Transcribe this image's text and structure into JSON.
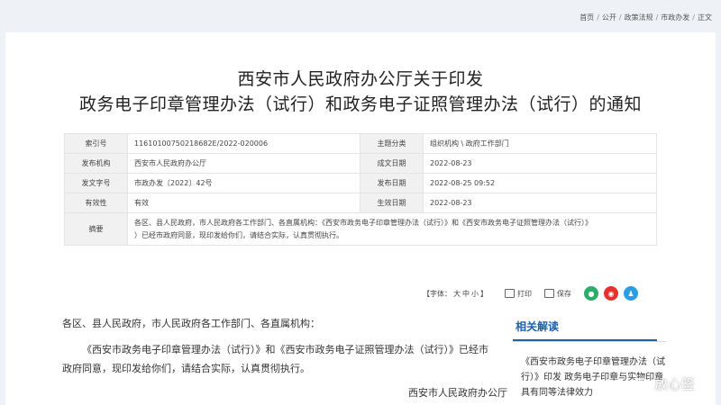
{
  "breadcrumb": [
    "首页",
    "公开",
    "政策法规",
    "市政办发",
    "正文"
  ],
  "title_line1": "西安市人民政府办公厅关于印发",
  "title_line2": "政务电子印章管理办法（试行）和政务电子证照管理办法（试行）的通知",
  "meta": {
    "index_label": "索引号",
    "index_value": "11610100750218682E/2022-020006",
    "category_label": "主题分类",
    "category_value": "组织机构 \\ 政府工作部门",
    "issuer_label": "发布机构",
    "issuer_value": "西安市人民政府办公厅",
    "created_label": "成文日期",
    "created_value": "2022-08-23",
    "docno_label": "发文字号",
    "docno_value": "市政办发〔2022〕42号",
    "published_label": "发布日期",
    "published_value": "2022-08-25 09:52",
    "validity_label": "有效性",
    "validity_value": "有效",
    "effective_label": "生效日期",
    "effective_value": "2022-08-23",
    "summary_label": "摘要",
    "summary_line1": "各区、县人民政府，市人民政府各工作部门、各直属机构：《西安市政务电子印章管理办法（试行）》和《西安市政务电子证照管理办法（试行）》",
    "summary_line2": "）已经市政府同意，现印发给你们，请结合实际，认真贯彻执行。"
  },
  "tools": {
    "font_label": "【字体：",
    "font_large": "大",
    "font_medium": "中",
    "font_small": "小",
    "font_end": "】",
    "print": "打印",
    "save": "保存",
    "wechat_color": "#2aae67",
    "weibo_color": "#e6322c",
    "qq_color": "#2a9de4"
  },
  "body": {
    "salutation": "各区、县人民政府，市人民政府各工作部门、各直属机构：",
    "paragraph": "《西安市政务电子印章管理办法（试行）》和《西安市政务电子证照管理办法（试行）》已经市政府同意，现印发给你们，请结合实际，认真贯彻执行。",
    "signature": "西安市人民政府办公厅"
  },
  "sidebar": {
    "title": "相关解读",
    "link_text": "《西安市政务电子印章管理办法（试行）》印发 政务电子印章与实物印章具有同等法律效力"
  },
  "watermark": {
    "text": "放心签"
  },
  "colors": {
    "accent": "#1f5fa8",
    "background": "#eef1f6"
  }
}
